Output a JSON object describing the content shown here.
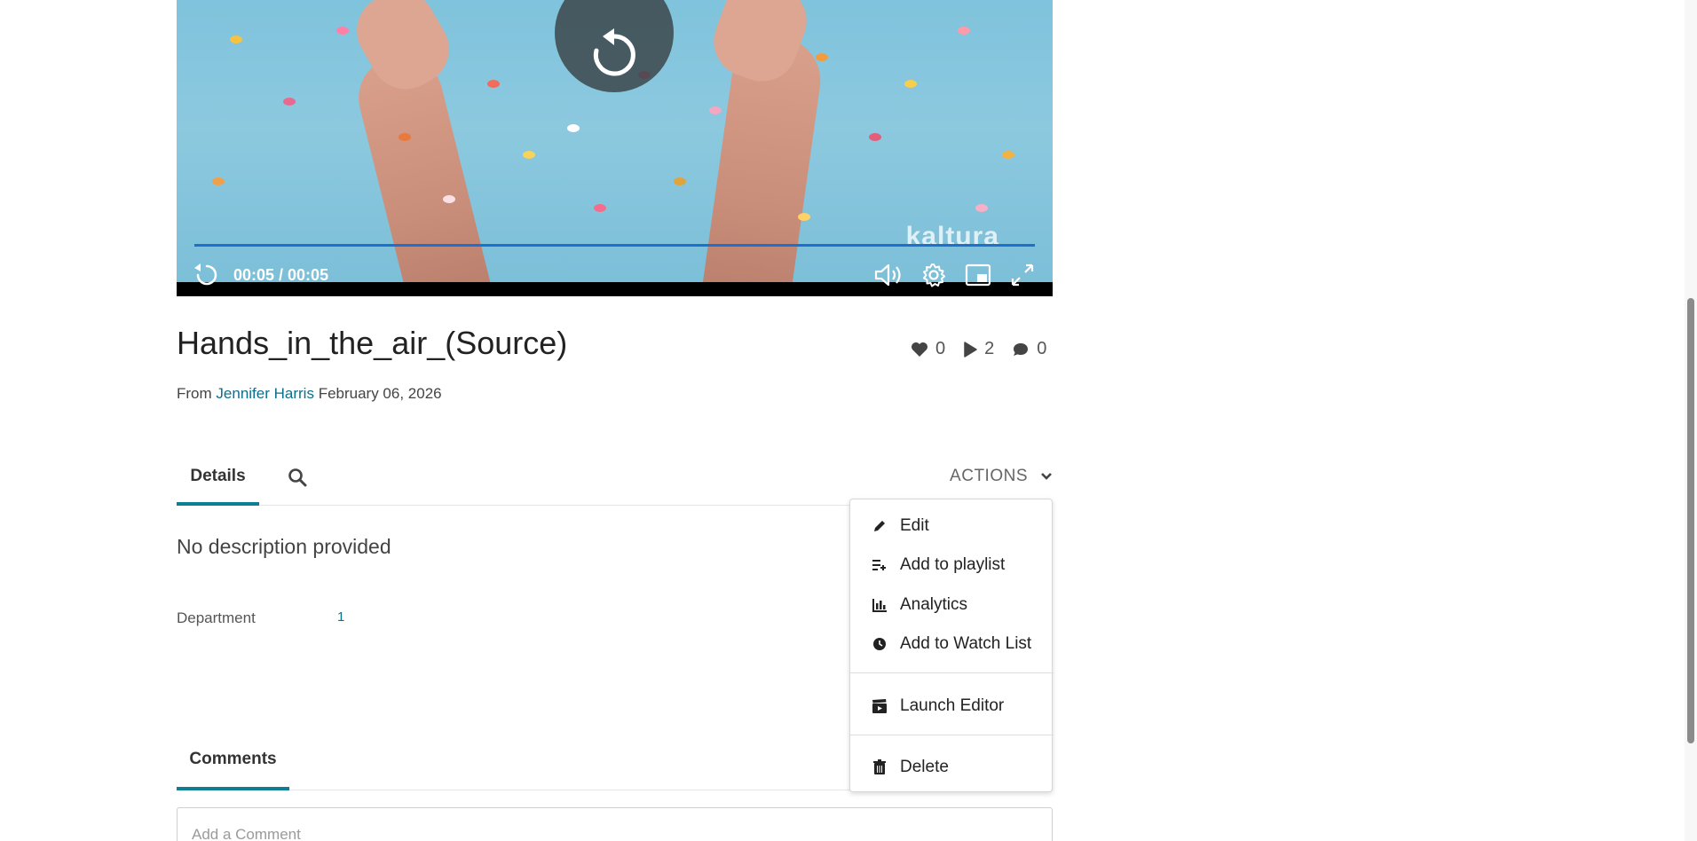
{
  "player": {
    "time": "00:05 / 00:05",
    "watermark": "kaltura",
    "progress": 1.0
  },
  "entry": {
    "title": "Hands_in_the_air_(Source)",
    "likes": "0",
    "plays": "2",
    "comments_count": "0",
    "from_label": "From",
    "author": "Jennifer Harris",
    "date": "February 06, 2026"
  },
  "tabs": {
    "details": "Details",
    "actions": "ACTIONS",
    "comments": "Comments"
  },
  "details": {
    "description": "No description provided",
    "department_label": "Department",
    "department_value": "1"
  },
  "actions_menu": {
    "items": [
      {
        "label": "Edit",
        "icon": "pencil-icon"
      },
      {
        "label": "Add to playlist",
        "icon": "playlist-add-icon"
      },
      {
        "label": "Analytics",
        "icon": "bar-chart-icon"
      },
      {
        "label": "Add to Watch List",
        "icon": "clock-icon"
      },
      {
        "label": "Launch Editor",
        "icon": "clapperboard-icon"
      },
      {
        "label": "Delete",
        "icon": "trash-icon"
      }
    ]
  },
  "comment": {
    "placeholder": "Add a Comment"
  }
}
